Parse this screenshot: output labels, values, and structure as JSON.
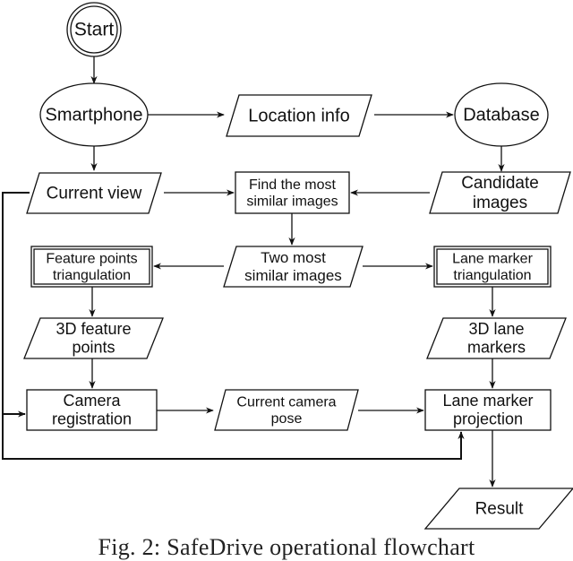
{
  "diagram": {
    "nodes": [
      {
        "id": "start",
        "shape": "double-circle",
        "lines": [
          "Start"
        ]
      },
      {
        "id": "smartphone",
        "shape": "ellipse",
        "lines": [
          "Smartphone"
        ]
      },
      {
        "id": "location-info",
        "shape": "parallelogram",
        "lines": [
          "Location info"
        ]
      },
      {
        "id": "database",
        "shape": "ellipse",
        "lines": [
          "Database"
        ]
      },
      {
        "id": "current-view",
        "shape": "parallelogram",
        "lines": [
          "Current view"
        ]
      },
      {
        "id": "find-similar",
        "shape": "rect",
        "lines": [
          "Find the most",
          "similar images"
        ]
      },
      {
        "id": "candidate-images",
        "shape": "parallelogram",
        "lines": [
          "Candidate",
          "images"
        ]
      },
      {
        "id": "feature-triangulation",
        "shape": "double-rect",
        "lines": [
          "Feature points",
          "triangulation"
        ]
      },
      {
        "id": "two-similar",
        "shape": "parallelogram",
        "lines": [
          "Two most",
          "similar images"
        ]
      },
      {
        "id": "lane-triangulation",
        "shape": "double-rect",
        "lines": [
          "Lane marker",
          "triangulation"
        ]
      },
      {
        "id": "3d-feature-points",
        "shape": "parallelogram",
        "lines": [
          "3D feature",
          "points"
        ]
      },
      {
        "id": "3d-lane-markers",
        "shape": "parallelogram",
        "lines": [
          "3D lane",
          "markers"
        ]
      },
      {
        "id": "camera-registration",
        "shape": "rect",
        "lines": [
          "Camera",
          "registration"
        ]
      },
      {
        "id": "current-camera-pose",
        "shape": "parallelogram",
        "lines": [
          "Current camera",
          "pose"
        ]
      },
      {
        "id": "lane-projection",
        "shape": "rect",
        "lines": [
          "Lane marker",
          "projection"
        ]
      },
      {
        "id": "result",
        "shape": "parallelogram",
        "lines": [
          "Result"
        ]
      }
    ],
    "edges": [
      {
        "from": "start",
        "to": "smartphone"
      },
      {
        "from": "smartphone",
        "to": "location-info"
      },
      {
        "from": "location-info",
        "to": "database"
      },
      {
        "from": "smartphone",
        "to": "current-view"
      },
      {
        "from": "database",
        "to": "candidate-images"
      },
      {
        "from": "current-view",
        "to": "find-similar"
      },
      {
        "from": "candidate-images",
        "to": "find-similar"
      },
      {
        "from": "find-similar",
        "to": "two-similar"
      },
      {
        "from": "two-similar",
        "to": "feature-triangulation"
      },
      {
        "from": "two-similar",
        "to": "lane-triangulation"
      },
      {
        "from": "feature-triangulation",
        "to": "3d-feature-points"
      },
      {
        "from": "lane-triangulation",
        "to": "3d-lane-markers"
      },
      {
        "from": "3d-feature-points",
        "to": "camera-registration"
      },
      {
        "from": "3d-lane-markers",
        "to": "lane-projection"
      },
      {
        "from": "current-view",
        "to": "camera-registration"
      },
      {
        "from": "camera-registration",
        "to": "current-camera-pose"
      },
      {
        "from": "current-camera-pose",
        "to": "lane-projection"
      },
      {
        "from": "current-view",
        "to": "lane-projection"
      },
      {
        "from": "lane-projection",
        "to": "result"
      }
    ]
  },
  "caption": "Fig. 2: SafeDrive operational flowchart"
}
